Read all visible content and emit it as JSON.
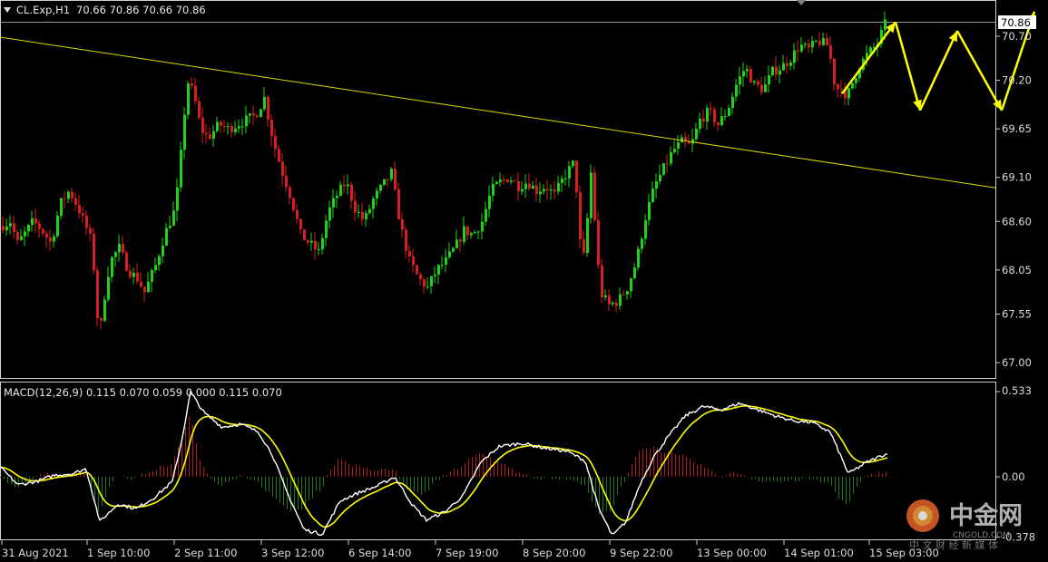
{
  "symbol_header": {
    "symbol": "CL.Exp,H1",
    "ohlc": "70.66 70.86 70.66 70.86"
  },
  "macd_header": "MACD(12,26,9) 0.115 0.070 0.059 0.000 0.115 0.070",
  "price_axis": {
    "ticks": [
      "70.70",
      "70.20",
      "69.65",
      "69.10",
      "68.60",
      "68.05",
      "67.55",
      "67.00"
    ],
    "tick_values": [
      70.7,
      70.2,
      69.65,
      69.1,
      68.6,
      68.05,
      67.55,
      67.0
    ],
    "current_price_label": "70.86",
    "range": [
      66.8,
      71.0
    ]
  },
  "macd_axis": {
    "ticks": [
      "0.533",
      "0.00",
      "-0.378"
    ],
    "tick_values": [
      0.533,
      0.0,
      -0.378
    ]
  },
  "time_axis": {
    "labels": [
      "31 Aug 2021",
      "1 Sep 10:00",
      "2 Sep 11:00",
      "3 Sep 12:00",
      "6 Sep 14:00",
      "7 Sep 19:00",
      "8 Sep 20:00",
      "9 Sep 22:00",
      "13 Sep 00:00",
      "14 Sep 01:00",
      "15 Sep 03:00"
    ]
  },
  "colors": {
    "bull": "#22d11a",
    "bear": "#d81e1e",
    "trendline": "#d9d900",
    "projection": "#ffff00",
    "macd_line": "#ffffff",
    "signal_line": "#ffff00",
    "hist_pos": "#b01c1c",
    "hist_neg": "#1f7a1f"
  },
  "watermark": {
    "brand": "中金网",
    "site": "CNGOLD.COM",
    "tagline": "中 文 财 经 新 媒 体"
  },
  "chart_data": {
    "type": "candlestick",
    "title": "CL.Exp,H1",
    "price_anchors": [
      [
        0,
        68.55
      ],
      [
        10,
        68.6
      ],
      [
        18,
        68.35
      ],
      [
        25,
        68.45
      ],
      [
        35,
        68.6
      ],
      [
        45,
        68.5
      ],
      [
        55,
        68.35
      ],
      [
        65,
        68.8
      ],
      [
        75,
        68.95
      ],
      [
        85,
        68.75
      ],
      [
        95,
        68.5
      ],
      [
        100,
        68.35
      ],
      [
        108,
        67.25
      ],
      [
        113,
        67.7
      ],
      [
        120,
        68.15
      ],
      [
        130,
        68.3
      ],
      [
        140,
        68.05
      ],
      [
        150,
        67.95
      ],
      [
        158,
        67.8
      ],
      [
        170,
        68.1
      ],
      [
        180,
        68.45
      ],
      [
        190,
        68.7
      ],
      [
        195,
        69.0
      ],
      [
        200,
        69.6
      ],
      [
        205,
        70.2
      ],
      [
        212,
        70.05
      ],
      [
        220,
        69.65
      ],
      [
        228,
        69.55
      ],
      [
        240,
        69.7
      ],
      [
        250,
        69.65
      ],
      [
        260,
        69.7
      ],
      [
        270,
        69.75
      ],
      [
        280,
        69.8
      ],
      [
        290,
        70.0
      ],
      [
        300,
        69.5
      ],
      [
        310,
        69.15
      ],
      [
        320,
        68.85
      ],
      [
        330,
        68.45
      ],
      [
        340,
        68.35
      ],
      [
        350,
        68.25
      ],
      [
        360,
        68.7
      ],
      [
        370,
        68.9
      ],
      [
        380,
        69.05
      ],
      [
        390,
        68.75
      ],
      [
        400,
        68.6
      ],
      [
        410,
        68.85
      ],
      [
        420,
        69.0
      ],
      [
        430,
        69.15
      ],
      [
        440,
        68.55
      ],
      [
        450,
        68.15
      ],
      [
        460,
        67.95
      ],
      [
        470,
        67.85
      ],
      [
        480,
        68.05
      ],
      [
        490,
        68.15
      ],
      [
        500,
        68.3
      ],
      [
        510,
        68.5
      ],
      [
        520,
        68.45
      ],
      [
        530,
        68.6
      ],
      [
        540,
        68.95
      ],
      [
        550,
        69.05
      ],
      [
        560,
        69.1
      ],
      [
        570,
        69.0
      ],
      [
        580,
        69.05
      ],
      [
        590,
        68.95
      ],
      [
        600,
        69.0
      ],
      [
        610,
        68.9
      ],
      [
        620,
        69.1
      ],
      [
        630,
        69.25
      ],
      [
        635,
        68.9
      ],
      [
        640,
        68.0
      ],
      [
        645,
        68.5
      ],
      [
        650,
        69.15
      ],
      [
        655,
        68.5
      ],
      [
        660,
        67.8
      ],
      [
        670,
        67.65
      ],
      [
        680,
        67.7
      ],
      [
        690,
        67.85
      ],
      [
        700,
        68.15
      ],
      [
        710,
        68.65
      ],
      [
        720,
        69.0
      ],
      [
        730,
        69.2
      ],
      [
        740,
        69.4
      ],
      [
        750,
        69.5
      ],
      [
        760,
        69.45
      ],
      [
        770,
        69.75
      ],
      [
        780,
        69.85
      ],
      [
        790,
        69.7
      ],
      [
        800,
        69.85
      ],
      [
        810,
        70.15
      ],
      [
        820,
        70.35
      ],
      [
        830,
        70.15
      ],
      [
        840,
        70.1
      ],
      [
        850,
        70.3
      ],
      [
        860,
        70.35
      ],
      [
        870,
        70.45
      ],
      [
        880,
        70.6
      ],
      [
        890,
        70.55
      ],
      [
        900,
        70.65
      ],
      [
        910,
        70.6
      ],
      [
        915,
        70.4
      ],
      [
        920,
        70.05
      ],
      [
        925,
        70.2
      ],
      [
        930,
        69.95
      ],
      [
        935,
        70.1
      ],
      [
        945,
        70.35
      ],
      [
        955,
        70.5
      ],
      [
        965,
        70.6
      ],
      [
        975,
        70.86
      ]
    ],
    "trendline": {
      "from": [
        "1 Sep",
        70.69
      ],
      "to": [
        "15 Sep",
        68.98
      ]
    },
    "projection_zigzag": [
      70.05,
      70.86,
      69.86,
      70.76,
      69.86,
      70.98
    ],
    "macd": {
      "anchors": [
        [
          0,
          0.06
        ],
        [
          20,
          -0.05
        ],
        [
          40,
          -0.03
        ],
        [
          60,
          0.01
        ],
        [
          80,
          0.02
        ],
        [
          95,
          0.05
        ],
        [
          110,
          -0.28
        ],
        [
          130,
          -0.17
        ],
        [
          150,
          -0.2
        ],
        [
          170,
          -0.13
        ],
        [
          190,
          -0.03
        ],
        [
          200,
          0.22
        ],
        [
          210,
          0.53
        ],
        [
          225,
          0.4
        ],
        [
          245,
          0.31
        ],
        [
          265,
          0.33
        ],
        [
          285,
          0.28
        ],
        [
          300,
          0.14
        ],
        [
          315,
          -0.08
        ],
        [
          335,
          -0.33
        ],
        [
          355,
          -0.36
        ],
        [
          375,
          -0.15
        ],
        [
          395,
          -0.1
        ],
        [
          415,
          -0.06
        ],
        [
          435,
          0.0
        ],
        [
          455,
          -0.18
        ],
        [
          470,
          -0.27
        ],
        [
          490,
          -0.22
        ],
        [
          510,
          -0.12
        ],
        [
          530,
          0.09
        ],
        [
          550,
          0.19
        ],
        [
          575,
          0.21
        ],
        [
          600,
          0.18
        ],
        [
          625,
          0.16
        ],
        [
          645,
          0.1
        ],
        [
          660,
          -0.2
        ],
        [
          675,
          -0.37
        ],
        [
          690,
          -0.28
        ],
        [
          705,
          -0.05
        ],
        [
          720,
          0.12
        ],
        [
          735,
          0.24
        ],
        [
          755,
          0.38
        ],
        [
          775,
          0.44
        ],
        [
          795,
          0.42
        ],
        [
          815,
          0.46
        ],
        [
          835,
          0.42
        ],
        [
          855,
          0.38
        ],
        [
          875,
          0.35
        ],
        [
          895,
          0.34
        ],
        [
          915,
          0.28
        ],
        [
          935,
          0.02
        ],
        [
          955,
          0.09
        ],
        [
          975,
          0.14
        ]
      ],
      "signal_lag": 14
    }
  }
}
